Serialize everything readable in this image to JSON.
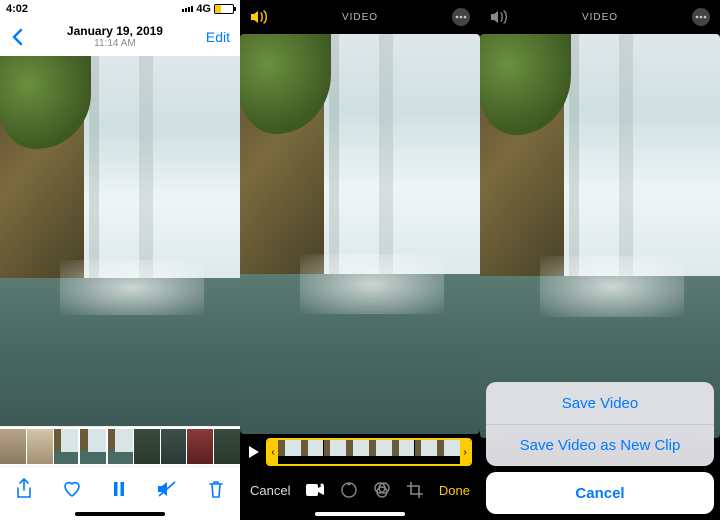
{
  "status": {
    "time": "4:02",
    "network": "4G"
  },
  "panel1": {
    "date": "January 19, 2019",
    "time": "11:14 AM",
    "edit": "Edit"
  },
  "editor": {
    "video_label": "VIDEO",
    "cancel": "Cancel",
    "done": "Done"
  },
  "sheet": {
    "save_video": "Save Video",
    "save_new_clip": "Save Video as New Clip",
    "cancel": "Cancel"
  },
  "icons": {
    "back": "chevron-left",
    "share": "share",
    "heart": "heart",
    "pause": "pause",
    "mute": "speaker-off",
    "trash": "trash",
    "speaker": "speaker",
    "more": "ellipsis",
    "play": "play",
    "camera": "video-camera",
    "adjust": "dial",
    "filters": "circles",
    "crop": "crop"
  }
}
